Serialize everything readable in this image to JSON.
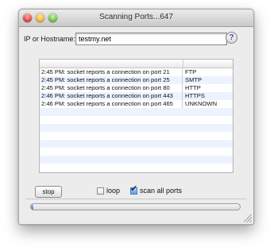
{
  "window": {
    "title": "Scanning Ports...647"
  },
  "host": {
    "label": "IP or Hostname:",
    "value": "testmy.net",
    "help_label": "?"
  },
  "results": {
    "rows": [
      {
        "message": "2:45 PM: socket reports a connection on port 21",
        "protocol": "FTP"
      },
      {
        "message": "2:45 PM: socket reports a connection on port 25",
        "protocol": "SMTP"
      },
      {
        "message": "2:45 PM: socket reports a connection on port 80",
        "protocol": "HTTP"
      },
      {
        "message": "2:46 PM: socket reports a connection on port 443",
        "protocol": "HTTPS"
      },
      {
        "message": "2:46 PM: socket reports a connection on port 465",
        "protocol": "UNKNOWN"
      }
    ]
  },
  "controls": {
    "stop_label": "stop",
    "loop_label": "loop",
    "loop_checked": false,
    "scan_all_label": "scan all ports",
    "scan_all_checked": true
  },
  "progress": {
    "fraction": 0.01
  },
  "colors": {
    "accent": "#3a7bd5",
    "row_alt": "#edf3fe",
    "help_mark": "#6b2fb3"
  }
}
